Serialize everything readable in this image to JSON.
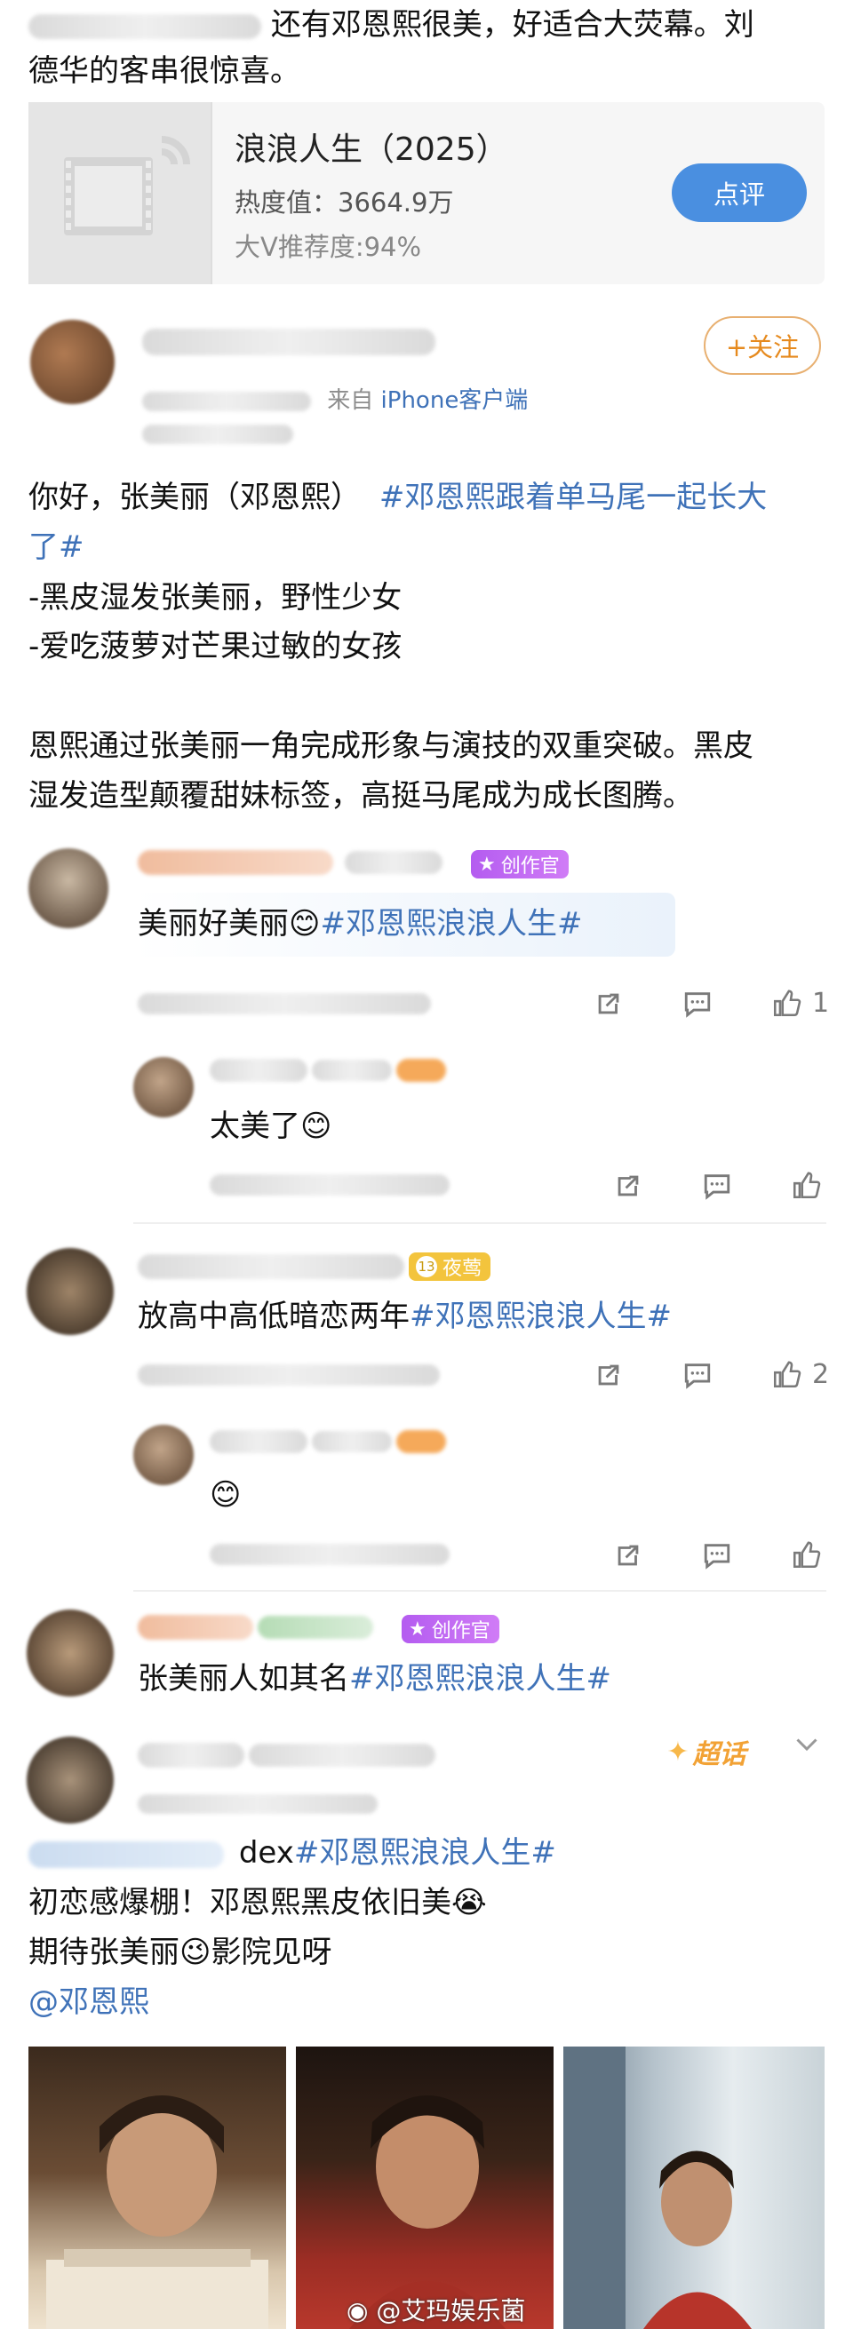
{
  "top_text": {
    "line1": "还有邓恩熙很美，好适合大荧幕。刘",
    "line2": "德华的客串很惊喜。"
  },
  "movie": {
    "title": "浪浪人生（2025）",
    "heat": "热度值：3664.9万",
    "recommend": "大V推荐度:94%",
    "button": "点评"
  },
  "post": {
    "source_prefix": "来自",
    "source": "iPhone客户端",
    "follow_button": "+关注",
    "greeting": "你好，张美丽（邓恩熙）",
    "hashtag1": "#邓恩熙跟着单马尾一起长大",
    "hashtag1_cont": "了#",
    "line2": "-黑皮湿发张美丽，野性少女",
    "line3": "-爱吃菠萝对芒果过敏的女孩",
    "para1": "恩熙通过张美丽一角完成形象与演技的双重突破。黑皮",
    "para2": "湿发造型颠覆甜妹标签，高挺马尾成为成长图腾。"
  },
  "comments": [
    {
      "badge": "创作官",
      "prefix": "美丽好美丽",
      "hashtag": "#邓恩熙浪浪人生#",
      "likes": "1",
      "reply": {
        "text": "太美了"
      }
    },
    {
      "badge": "夜莺",
      "badge_level": "13",
      "prefix": "放高中高低暗恋两年",
      "hashtag": "#邓恩熙浪浪人生#",
      "likes": "2",
      "reply": {
        "text": ""
      }
    },
    {
      "badge": "创作官",
      "prefix": "张美丽人如其名",
      "hashtag": "#邓恩熙浪浪人生#"
    }
  ],
  "post2": {
    "super_topic": "超话",
    "line1_prefix": "dex",
    "line1_hashtag": "#邓恩熙浪浪人生#",
    "line2": "初恋感爆棚！邓恩熙黑皮依旧美",
    "line3_a": "期待张美丽",
    "line3_b": "影院见呀",
    "mention": "@邓恩熙"
  },
  "watermark": "@艾玛娱乐菌",
  "colors": {
    "link": "#3f72b8",
    "button": "#4a8fe0",
    "follow": "#e68a1e"
  }
}
